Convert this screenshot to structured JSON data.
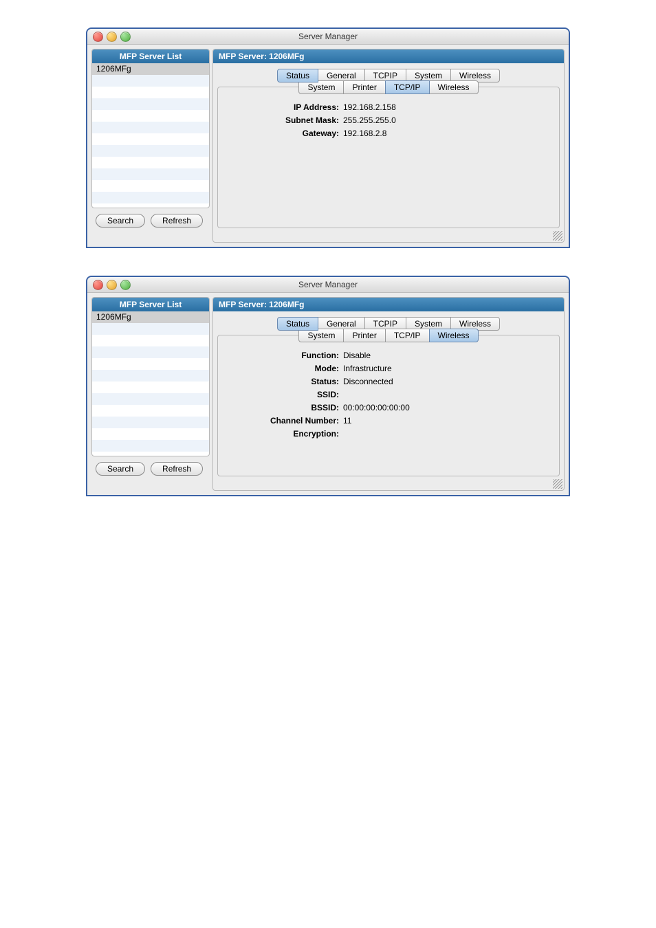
{
  "windows": [
    {
      "title": "Server Manager",
      "sidebar": {
        "header": "MFP Server List",
        "items": [
          "1206MFg"
        ]
      },
      "main": {
        "header": "MFP Server: 1206MFg",
        "outerTabs": [
          "Status",
          "General",
          "TCPIP",
          "System",
          "Wireless"
        ],
        "outerActive": "Status",
        "innerTabs": [
          "System",
          "Printer",
          "TCP/IP",
          "Wireless"
        ],
        "innerActive": "TCP/IP",
        "fields": [
          {
            "label": "IP Address:",
            "value": "192.168.2.158"
          },
          {
            "label": "Subnet Mask:",
            "value": "255.255.255.0"
          },
          {
            "label": "Gateway:",
            "value": "192.168.2.8"
          }
        ]
      },
      "buttons": {
        "search": "Search",
        "refresh": "Refresh"
      }
    },
    {
      "title": "Server Manager",
      "sidebar": {
        "header": "MFP Server List",
        "items": [
          "1206MFg"
        ]
      },
      "main": {
        "header": "MFP Server: 1206MFg",
        "outerTabs": [
          "Status",
          "General",
          "TCPIP",
          "System",
          "Wireless"
        ],
        "outerActive": "Status",
        "innerTabs": [
          "System",
          "Printer",
          "TCP/IP",
          "Wireless"
        ],
        "innerActive": "Wireless",
        "fields": [
          {
            "label": "Function:",
            "value": "Disable"
          },
          {
            "label": "Mode:",
            "value": "Infrastructure"
          },
          {
            "label": "Status:",
            "value": "Disconnected"
          },
          {
            "label": "SSID:",
            "value": ""
          },
          {
            "label": "BSSID:",
            "value": "00:00:00:00:00:00"
          },
          {
            "label": "Channel Number:",
            "value": "11"
          },
          {
            "label": "Encryption:",
            "value": ""
          }
        ]
      },
      "buttons": {
        "search": "Search",
        "refresh": "Refresh"
      }
    }
  ]
}
